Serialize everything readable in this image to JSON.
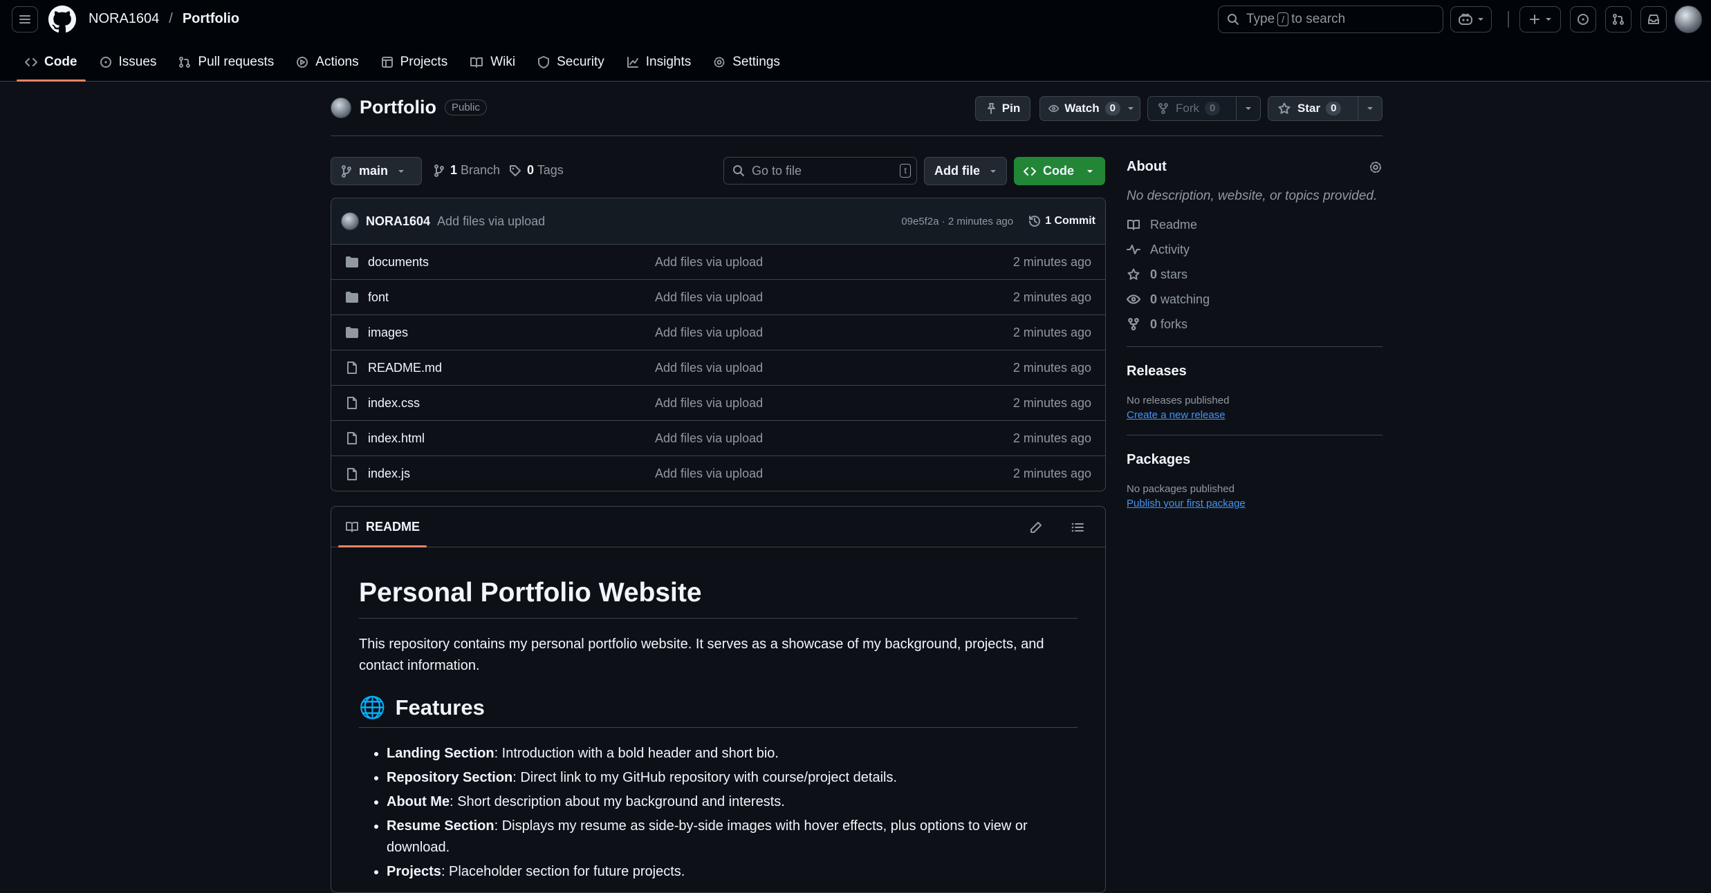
{
  "header": {
    "owner": "NORA1604",
    "separator": "/",
    "repo": "Portfolio",
    "search_prefix": "Type",
    "search_key": "/",
    "search_suffix": "to search"
  },
  "nav": {
    "code": "Code",
    "issues": "Issues",
    "pulls": "Pull requests",
    "actions": "Actions",
    "projects": "Projects",
    "wiki": "Wiki",
    "security": "Security",
    "insights": "Insights",
    "settings": "Settings"
  },
  "repo": {
    "name": "Portfolio",
    "visibility": "Public",
    "pin": "Pin",
    "watch": "Watch",
    "watch_count": "0",
    "fork": "Fork",
    "fork_count": "0",
    "star": "Star",
    "star_count": "0"
  },
  "toolbar": {
    "branch": "main",
    "branches_count": "1",
    "branches_label": "Branch",
    "tags_count": "0",
    "tags_label": "Tags",
    "goto_placeholder": "Go to file",
    "goto_key": "t",
    "add_file": "Add file",
    "code": "Code"
  },
  "commit": {
    "user": "NORA1604",
    "message": "Add files via upload",
    "meta": "09e5f2a · 2 minutes ago",
    "commits": "1 Commit"
  },
  "files": [
    {
      "name": "documents",
      "type": "folder",
      "message": "Add files via upload",
      "time": "2 minutes ago"
    },
    {
      "name": "font",
      "type": "folder",
      "message": "Add files via upload",
      "time": "2 minutes ago"
    },
    {
      "name": "images",
      "type": "folder",
      "message": "Add files via upload",
      "time": "2 minutes ago"
    },
    {
      "name": "README.md",
      "type": "file",
      "message": "Add files via upload",
      "time": "2 minutes ago"
    },
    {
      "name": "index.css",
      "type": "file",
      "message": "Add files via upload",
      "time": "2 minutes ago"
    },
    {
      "name": "index.html",
      "type": "file",
      "message": "Add files via upload",
      "time": "2 minutes ago"
    },
    {
      "name": "index.js",
      "type": "file",
      "message": "Add files via upload",
      "time": "2 minutes ago"
    }
  ],
  "readme": {
    "tab": "README",
    "h1": "Personal Portfolio Website",
    "intro": "This repository contains my personal portfolio website. It serves as a showcase of my background, projects, and contact information.",
    "features_emoji": "🌐",
    "features_title": "Features",
    "features": [
      {
        "term": "Landing Section",
        "desc": ": Introduction with a bold header and short bio."
      },
      {
        "term": "Repository Section",
        "desc": ": Direct link to my GitHub repository with course/project details."
      },
      {
        "term": "About Me",
        "desc": ": Short description about my background and interests."
      },
      {
        "term": "Resume Section",
        "desc": ": Displays my resume as side-by-side images with hover effects, plus options to view or download."
      },
      {
        "term": "Projects",
        "desc": ": Placeholder section for future projects."
      }
    ]
  },
  "sidebar": {
    "about_title": "About",
    "about_desc": "No description, website, or topics provided.",
    "readme": "Readme",
    "activity": "Activity",
    "stars_count": "0",
    "stars_label": "stars",
    "watching_count": "0",
    "watching_label": "watching",
    "forks_count": "0",
    "forks_label": "forks",
    "releases_title": "Releases",
    "releases_none": "No releases published",
    "releases_link": "Create a new release",
    "packages_title": "Packages",
    "packages_none": "No packages published",
    "packages_link": "Publish your first package"
  },
  "colors": {
    "accent_tab": "#f78166",
    "code_button": "#238636",
    "link": "#4493f8",
    "background": "#0d1117"
  }
}
